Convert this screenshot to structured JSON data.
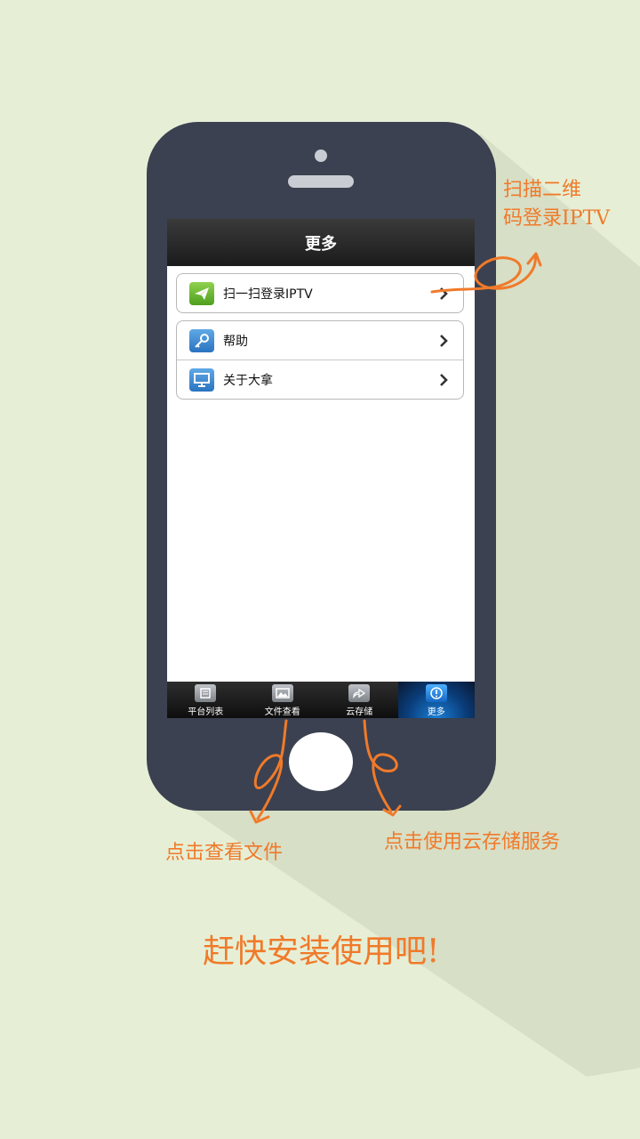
{
  "screen": {
    "nav_title": "更多",
    "menu": [
      {
        "label": "扫一扫登录IPTV",
        "icon": "paper-plane-icon"
      },
      {
        "label": "帮助",
        "icon": "key-icon"
      },
      {
        "label": "关于大拿",
        "icon": "monitor-icon"
      }
    ],
    "tabs": [
      {
        "label": "平台列表",
        "icon": "list-icon"
      },
      {
        "label": "文件查看",
        "icon": "picture-icon"
      },
      {
        "label": "云存储",
        "icon": "cloud-share-icon"
      },
      {
        "label": "更多",
        "icon": "info-icon",
        "active": true
      }
    ]
  },
  "annotations": {
    "scan": "扫描二维\n码登录IPTV",
    "view_files": "点击查看文件",
    "cloud": "点击使用云存储服务",
    "cta": "赶快安装使用吧!"
  },
  "colors": {
    "background": "#e6efd6",
    "phone_body": "#3b4150",
    "annotation": "#f07a2a",
    "active_tab": "#1b7fd6"
  }
}
